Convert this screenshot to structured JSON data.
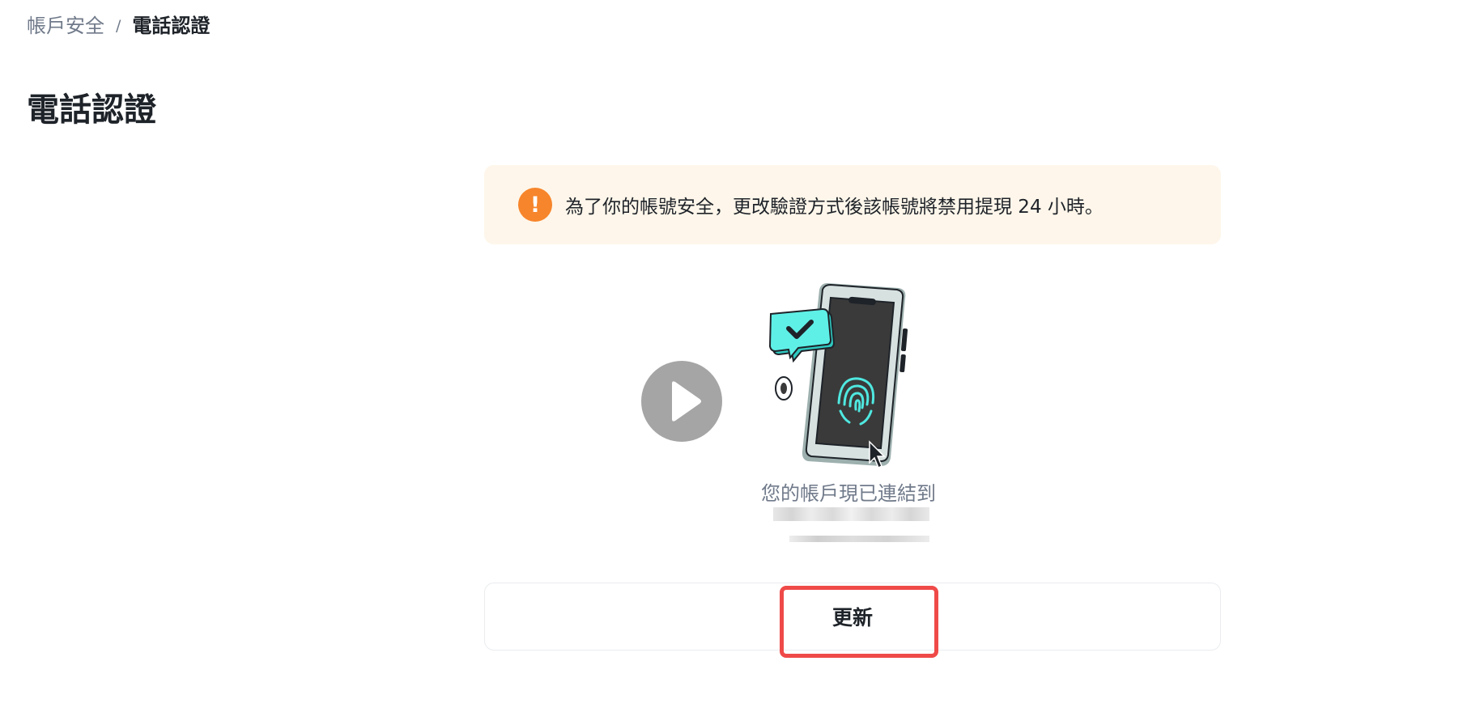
{
  "breadcrumb": {
    "parent": "帳戶安全",
    "separator": "/",
    "current": "電話認證"
  },
  "page_title": "電話認證",
  "alert": {
    "icon": "exclamation-icon",
    "icon_glyph": "!",
    "message": "為了你的帳號安全，更改驗證方式後該帳號將禁用提現 24 小時。",
    "accent_color": "#f7852b",
    "background_color": "#fef6ea"
  },
  "video": {
    "icon": "play-icon"
  },
  "status": {
    "label": "您的帳戶現已連結到"
  },
  "actions": {
    "update_label": "更新"
  },
  "colors": {
    "highlight": "#ef4a48",
    "illustration_accent": "#4fe8e0",
    "text_primary": "#1e2329",
    "text_secondary": "#707a8a"
  }
}
